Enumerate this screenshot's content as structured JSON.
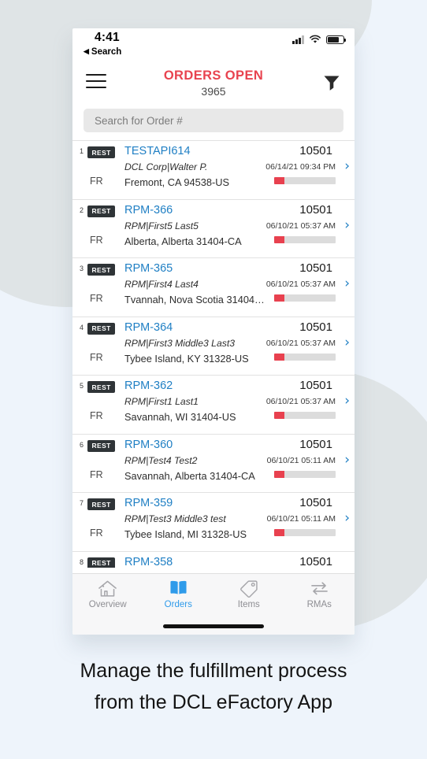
{
  "status_bar": {
    "time": "4:41",
    "back_label": "Search",
    "back_arrow": "◀",
    "signal_icon": "cellular-signal-icon",
    "wifi_icon": "wifi-icon",
    "battery_icon": "battery-icon"
  },
  "nav": {
    "menu_icon": "hamburger-menu-icon",
    "title": "ORDERS OPEN",
    "count": "3965",
    "filter_icon": "filter-funnel-icon",
    "title_color": "#e8434f"
  },
  "search": {
    "placeholder": "Search for Order #",
    "value": ""
  },
  "orders": [
    {
      "index": "1",
      "badge": "REST",
      "carrier": "FR",
      "order_no": "TESTAPI614",
      "customer": "DCL Corp|Walter P.",
      "address": "Fremont, CA 94538-US",
      "qty": "10501",
      "date": "06/14/21 09:34 PM",
      "progress": 17,
      "chevron_icon": "chevron-right-icon"
    },
    {
      "index": "2",
      "badge": "REST",
      "carrier": "FR",
      "order_no": "RPM-366",
      "customer": "RPM|First5 Last5",
      "address": "Alberta, Alberta 31404-CA",
      "qty": "10501",
      "date": "06/10/21 05:37 AM",
      "progress": 17,
      "chevron_icon": "chevron-right-icon"
    },
    {
      "index": "3",
      "badge": "REST",
      "carrier": "FR",
      "order_no": "RPM-365",
      "customer": "RPM|First4 Last4",
      "address": "Tvannah, Nova Scotia 31404…",
      "qty": "10501",
      "date": "06/10/21 05:37 AM",
      "progress": 17,
      "chevron_icon": "chevron-right-icon"
    },
    {
      "index": "4",
      "badge": "REST",
      "carrier": "FR",
      "order_no": "RPM-364",
      "customer": "RPM|First3 Middle3 Last3",
      "address": "Tybee Island, KY 31328-US",
      "qty": "10501",
      "date": "06/10/21 05:37 AM",
      "progress": 17,
      "chevron_icon": "chevron-right-icon"
    },
    {
      "index": "5",
      "badge": "REST",
      "carrier": "FR",
      "order_no": "RPM-362",
      "customer": "RPM|First1 Last1",
      "address": "Savannah, WI 31404-US",
      "qty": "10501",
      "date": "06/10/21 05:37 AM",
      "progress": 17,
      "chevron_icon": "chevron-right-icon"
    },
    {
      "index": "6",
      "badge": "REST",
      "carrier": "FR",
      "order_no": "RPM-360",
      "customer": "RPM|Test4 Test2",
      "address": "Savannah, Alberta 31404-CA",
      "qty": "10501",
      "date": "06/10/21 05:11 AM",
      "progress": 17,
      "chevron_icon": "chevron-right-icon"
    },
    {
      "index": "7",
      "badge": "REST",
      "carrier": "FR",
      "order_no": "RPM-359",
      "customer": "RPM|Test3 Middle3 test",
      "address": "Tybee Island, MI 31328-US",
      "qty": "10501",
      "date": "06/10/21 05:11 AM",
      "progress": 17,
      "chevron_icon": "chevron-right-icon"
    },
    {
      "index": "8",
      "badge": "REST",
      "carrier": "",
      "order_no": "RPM-358",
      "customer": "",
      "address": "",
      "qty": "10501",
      "date": "",
      "progress": 0,
      "chevron_icon": "chevron-right-icon"
    }
  ],
  "tabs": [
    {
      "label": "Overview",
      "icon": "home-icon",
      "active": false
    },
    {
      "label": "Orders",
      "icon": "book-icon",
      "active": true
    },
    {
      "label": "Items",
      "icon": "tag-icon",
      "active": false
    },
    {
      "label": "RMAs",
      "icon": "swap-arrows-icon",
      "active": false
    }
  ],
  "caption": {
    "line1": "Manage the fulfillment process",
    "line2": "from the DCL eFactory App"
  },
  "colors": {
    "accent_red": "#e8414f",
    "link_blue": "#1f7fc4",
    "active_tab_blue": "#2f9bea",
    "page_background": "#eef4fb",
    "blob_gray": "#dfe4e6"
  }
}
